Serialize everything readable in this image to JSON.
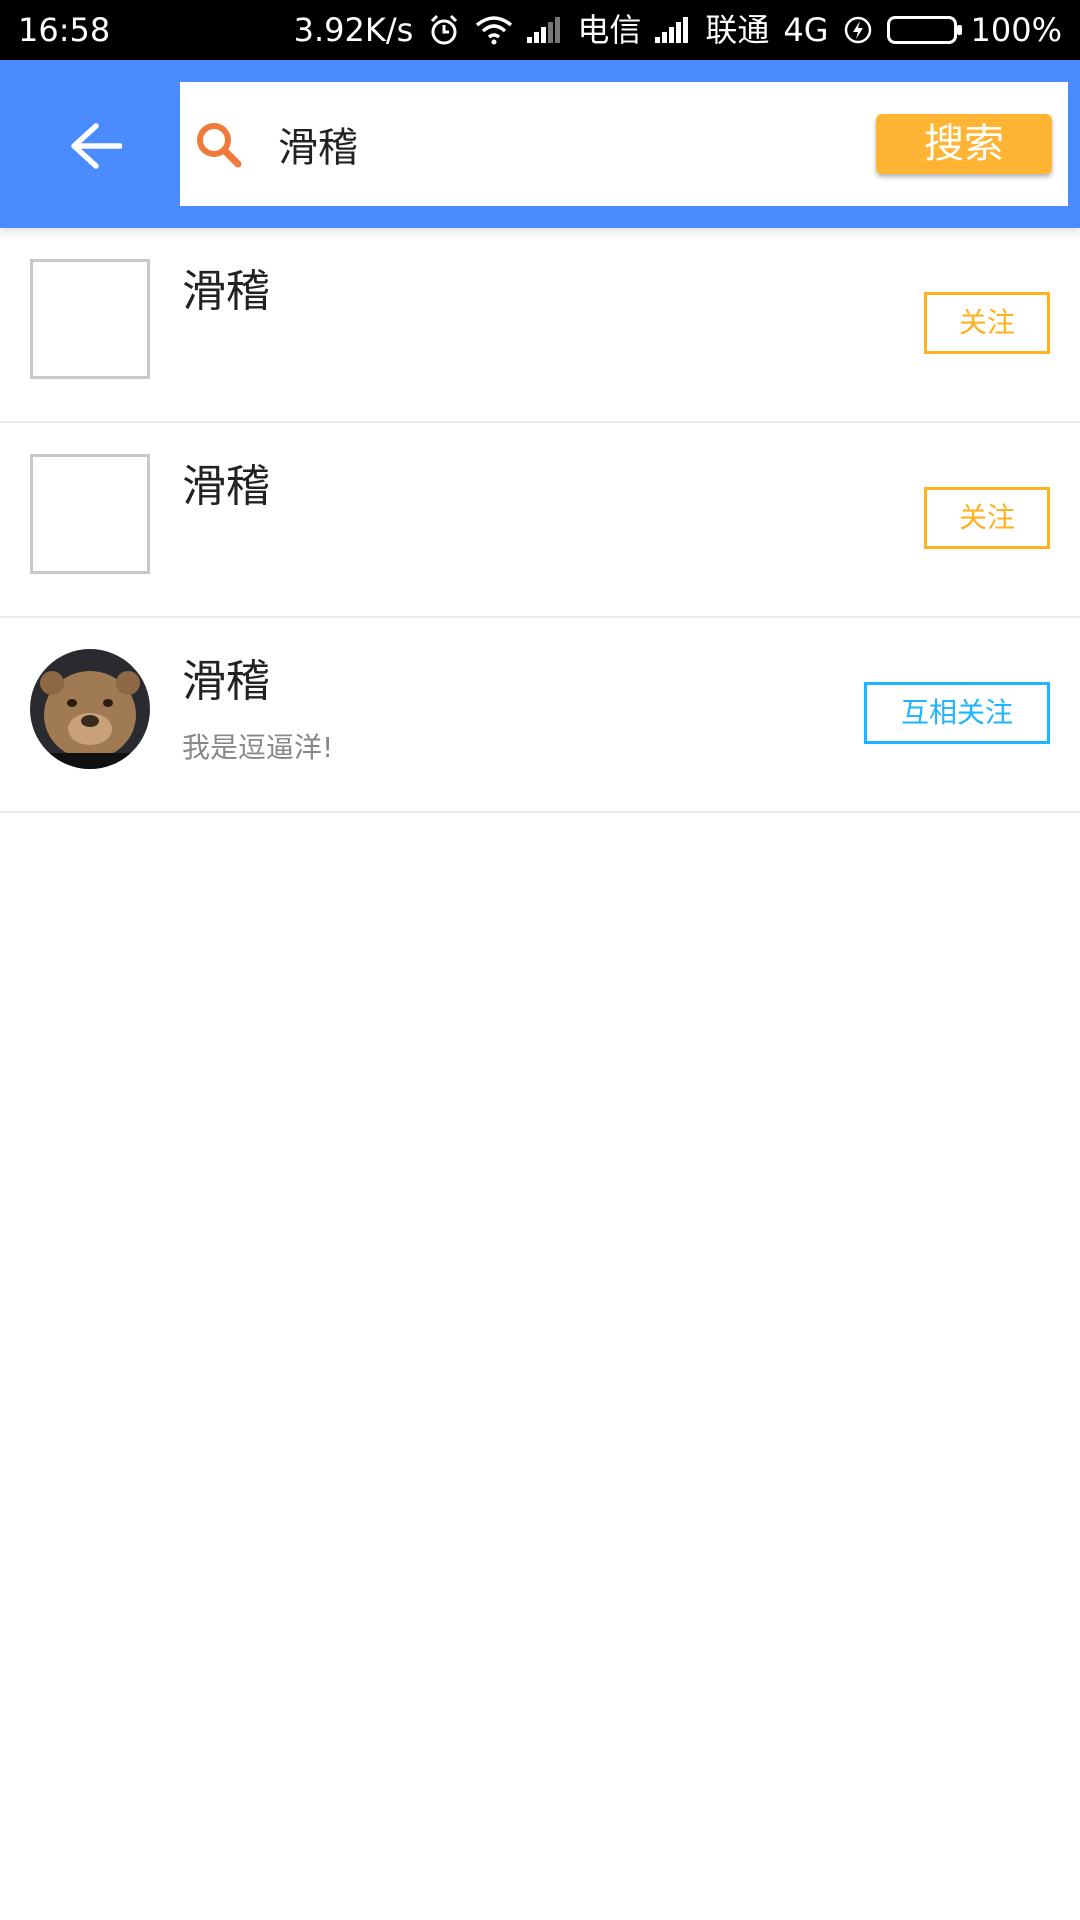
{
  "status_bar": {
    "time": "16:58",
    "net_speed": "3.92K/s",
    "carrier1": "电信",
    "carrier2": "联通",
    "network_type": "4G",
    "battery": "100%"
  },
  "header": {
    "search_query": "滑稽",
    "search_button_label": "搜索"
  },
  "results": [
    {
      "name": "滑稽",
      "signature": "",
      "avatar": "placeholder",
      "follow_label": "关注"
    },
    {
      "name": "滑稽",
      "signature": "",
      "avatar": "placeholder",
      "follow_label": "关注"
    },
    {
      "name": "滑稽",
      "signature": "我是逗逼洋!",
      "avatar": "bear-photo",
      "follow_label": "互相关注"
    }
  ],
  "colors": {
    "app_bar": "#4a8cff",
    "search_button": "#ffb533",
    "follow_button": "#ffb21f",
    "mutual_follow_button": "#1eb4ff",
    "search_icon": "#f07a3c"
  }
}
